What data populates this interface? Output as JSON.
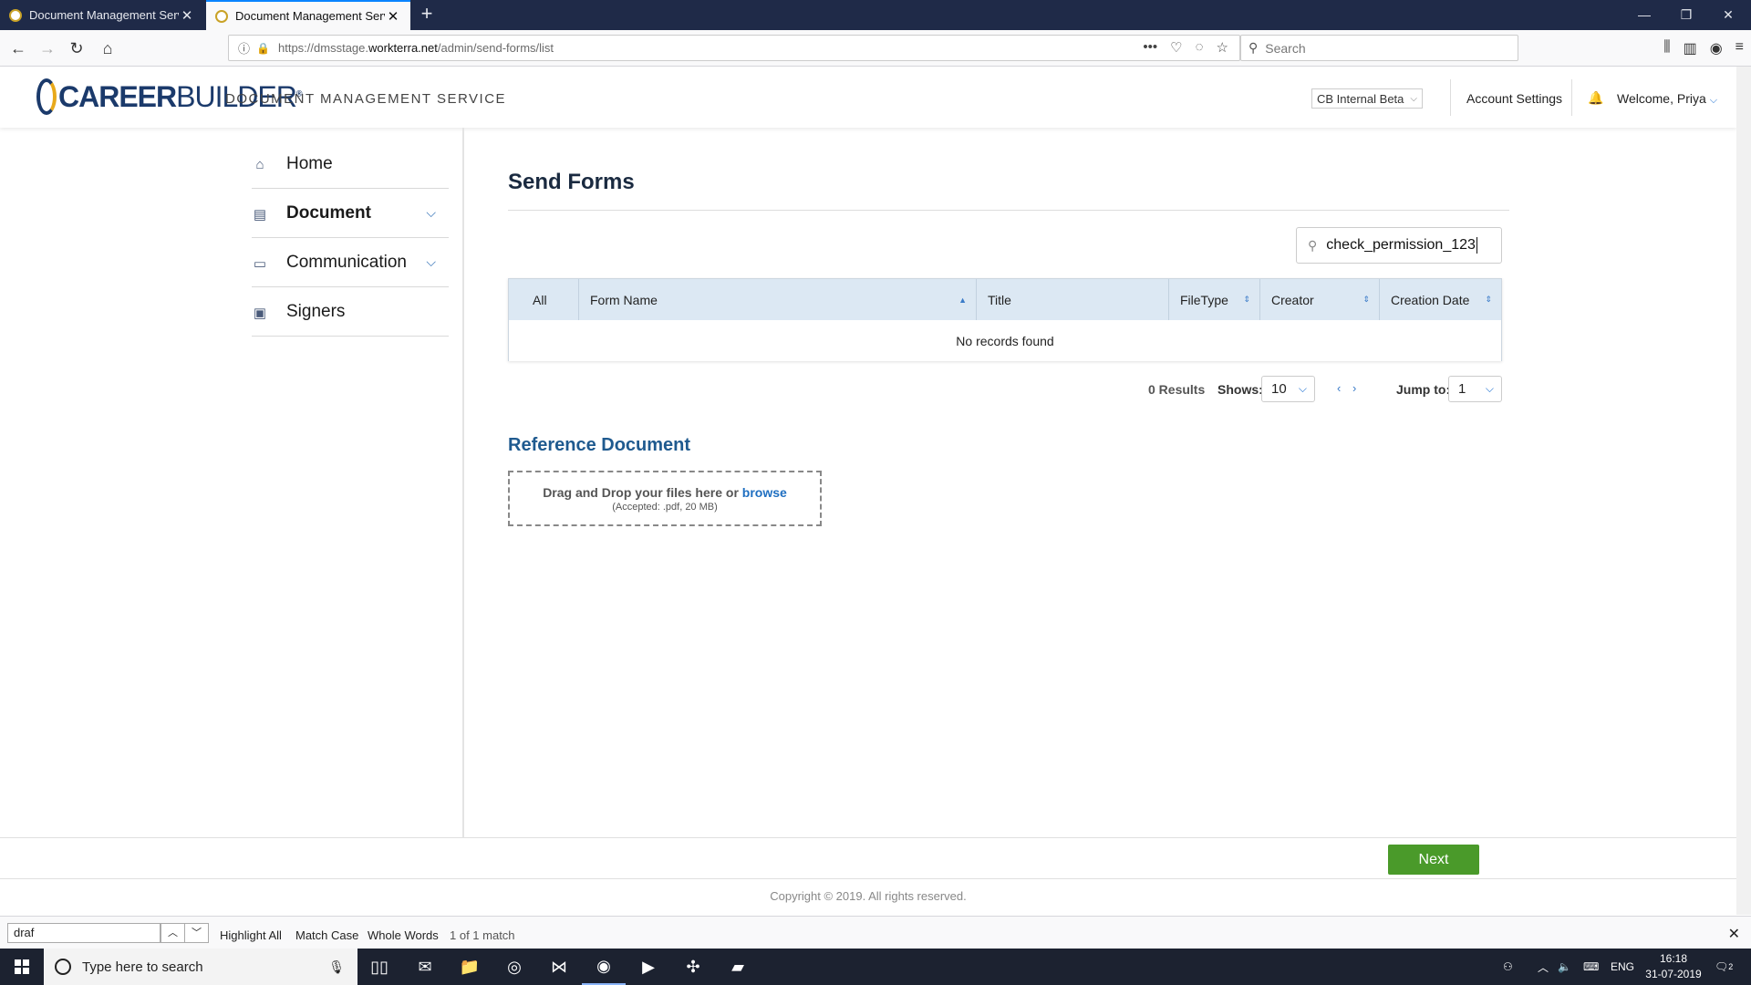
{
  "browser": {
    "tabs": [
      {
        "label": "Document Management Servic",
        "active": false
      },
      {
        "label": "Document Management Servic",
        "active": true
      }
    ],
    "new_tab": "+",
    "url_prefix": "https://dmsstage.",
    "url_domain": "workterra.net",
    "url_path": "/admin/send-forms/list",
    "search_placeholder": "Search"
  },
  "header": {
    "logo_bold": "CAREER",
    "logo_thin": "BUILDER",
    "logo_mark": "®",
    "service_title": "DOCUMENT MANAGEMENT SERVICE",
    "environment": "CB Internal Beta",
    "account_settings": "Account Settings",
    "welcome": "Welcome, Priya"
  },
  "sidebar": {
    "items": [
      {
        "label": "Home",
        "icon": "home-icon"
      },
      {
        "label": "Document",
        "icon": "document-icon",
        "active": true
      },
      {
        "label": "Communication",
        "icon": "chat-icon"
      },
      {
        "label": "Signers",
        "icon": "badge-icon"
      }
    ]
  },
  "main": {
    "title": "Send Forms",
    "search_value": "check_permission_123",
    "columns": [
      "All",
      "Form Name",
      "Title",
      "FileType",
      "Creator",
      "Creation Date"
    ],
    "empty_text": "No records found",
    "results": "0 Results",
    "shows_label": "Shows:",
    "page_size": "10",
    "jump_label": "Jump to:",
    "jump_value": "1",
    "ref_title": "Reference Document",
    "drop_text": "Drag and Drop your files here or",
    "browse_link": "browse",
    "accepted": "(Accepted: .pdf, 20 MB)"
  },
  "footer": {
    "next_label": "Next",
    "copyright": "Copyright © 2019. All rights reserved."
  },
  "findbar": {
    "query": "draf",
    "highlight_all": "Highlight All",
    "match_case": "Match Case",
    "whole_words": "Whole Words",
    "match_status": "1 of 1 match"
  },
  "taskbar": {
    "search_placeholder": "Type here to search",
    "language": "ENG",
    "time": "16:18",
    "date": "31-07-2019",
    "notifications": "2"
  },
  "colors": {
    "brand_navy": "#1b3a6b",
    "accent_blue": "#1f5a8f",
    "next_green": "#4a9a2a",
    "grid_header": "#dce8f3"
  }
}
